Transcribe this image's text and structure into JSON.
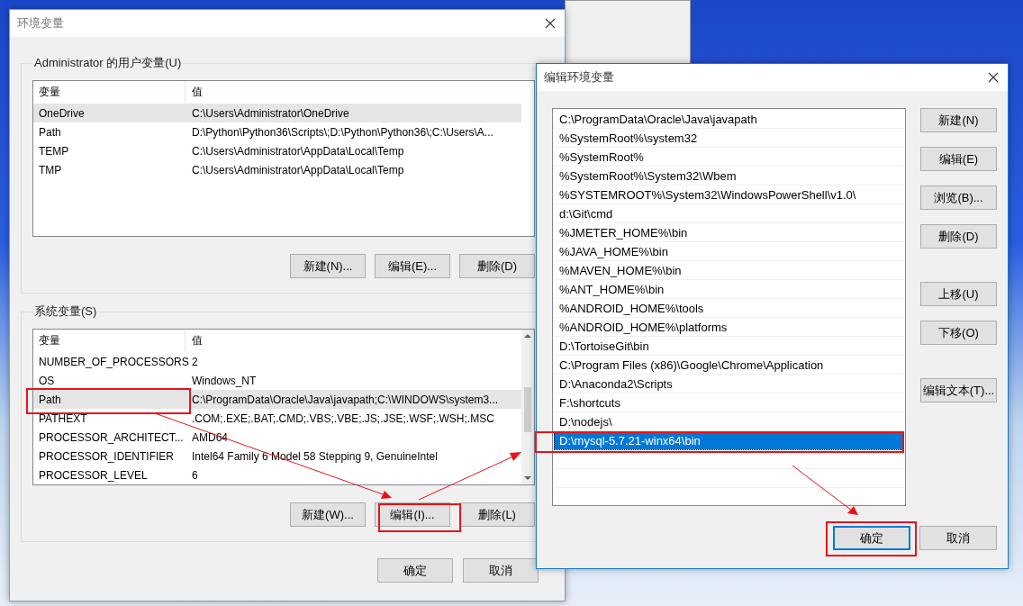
{
  "env_window": {
    "title": "环境变量",
    "user_vars": {
      "label": "Administrator 的用户变量(U)",
      "columns": [
        "变量",
        "值"
      ],
      "rows": [
        {
          "name": "OneDrive",
          "value": "C:\\Users\\Administrator\\OneDrive",
          "selected": true
        },
        {
          "name": "Path",
          "value": "D:\\Python\\Python36\\Scripts\\;D:\\Python\\Python36\\;C:\\Users\\A...",
          "selected": false
        },
        {
          "name": "TEMP",
          "value": "C:\\Users\\Administrator\\AppData\\Local\\Temp",
          "selected": false
        },
        {
          "name": "TMP",
          "value": "C:\\Users\\Administrator\\AppData\\Local\\Temp",
          "selected": false
        }
      ],
      "buttons": [
        "新建(N)...",
        "编辑(E)...",
        "删除(D)"
      ]
    },
    "system_vars": {
      "label": "系统变量(S)",
      "columns": [
        "变量",
        "值"
      ],
      "rows": [
        {
          "name": "NUMBER_OF_PROCESSORS",
          "value": "2",
          "selected": false
        },
        {
          "name": "OS",
          "value": "Windows_NT",
          "selected": false
        },
        {
          "name": "Path",
          "value": "C:\\ProgramData\\Oracle\\Java\\javapath;C:\\WINDOWS\\system3...",
          "selected": true
        },
        {
          "name": "PATHEXT",
          "value": ".COM;.EXE;.BAT;.CMD;.VBS;.VBE;.JS;.JSE;.WSF;.WSH;.MSC",
          "selected": false
        },
        {
          "name": "PROCESSOR_ARCHITECT...",
          "value": "AMD64",
          "selected": false
        },
        {
          "name": "PROCESSOR_IDENTIFIER",
          "value": "Intel64 Family 6 Model 58 Stepping 9, GenuineIntel",
          "selected": false
        },
        {
          "name": "PROCESSOR_LEVEL",
          "value": "6",
          "selected": false
        }
      ],
      "buttons": [
        "新建(W)...",
        "编辑(I)...",
        "删除(L)"
      ]
    },
    "buttons": [
      "确定",
      "取消"
    ]
  },
  "edit_window": {
    "title": "编辑环境变量",
    "entries": [
      {
        "text": "C:\\ProgramData\\Oracle\\Java\\javapath",
        "selected": false
      },
      {
        "text": "%SystemRoot%\\system32",
        "selected": false
      },
      {
        "text": "%SystemRoot%",
        "selected": false
      },
      {
        "text": "%SystemRoot%\\System32\\Wbem",
        "selected": false
      },
      {
        "text": "%SYSTEMROOT%\\System32\\WindowsPowerShell\\v1.0\\",
        "selected": false
      },
      {
        "text": "d:\\Git\\cmd",
        "selected": false
      },
      {
        "text": "%JMETER_HOME%\\bin",
        "selected": false
      },
      {
        "text": "%JAVA_HOME%\\bin",
        "selected": false
      },
      {
        "text": "%MAVEN_HOME%\\bin",
        "selected": false
      },
      {
        "text": "%ANT_HOME%\\bin",
        "selected": false
      },
      {
        "text": "%ANDROID_HOME%\\tools",
        "selected": false
      },
      {
        "text": "%ANDROID_HOME%\\platforms",
        "selected": false
      },
      {
        "text": "D:\\TortoiseGit\\bin",
        "selected": false
      },
      {
        "text": "C:\\Program Files (x86)\\Google\\Chrome\\Application",
        "selected": false
      },
      {
        "text": "D:\\Anaconda2\\Scripts",
        "selected": false
      },
      {
        "text": "F:\\shortcuts",
        "selected": false
      },
      {
        "text": "D:\\nodejs\\",
        "selected": false
      },
      {
        "text": "D:\\mysql-5.7.21-winx64\\bin",
        "selected": true
      }
    ],
    "side_buttons": [
      [
        "新建(N)",
        "编辑(E)",
        "浏览(B)...",
        "删除(D)"
      ],
      [
        "上移(U)",
        "下移(O)"
      ],
      [
        "编辑文本(T)..."
      ]
    ],
    "buttons": [
      {
        "label": "确定",
        "default": true
      },
      {
        "label": "取消",
        "default": false
      }
    ]
  }
}
